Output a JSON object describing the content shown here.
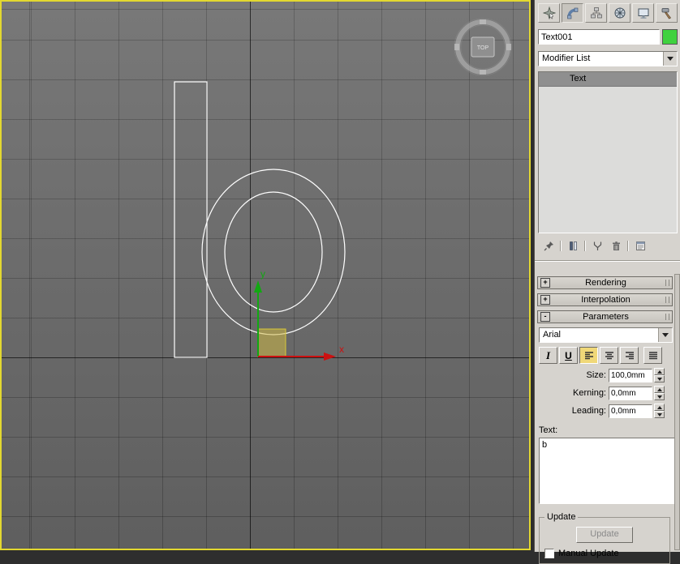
{
  "viewport": {
    "view_label": "TOP",
    "letter": "b",
    "axis_x_label": "x",
    "axis_y_label": "y",
    "colors": {
      "spline": "#ffffff",
      "axis_x": "#cc1111",
      "axis_y": "#12a812",
      "plane_handle_fill": "#cdb845",
      "plane_handle_stroke": "#d8c838",
      "active_border": "#e3d830"
    }
  },
  "command_panel": {
    "tabs": [
      {
        "icon": "create-icon"
      },
      {
        "icon": "modify-icon"
      },
      {
        "icon": "hierarchy-icon"
      },
      {
        "icon": "motion-icon"
      },
      {
        "icon": "display-icon"
      },
      {
        "icon": "utilities-icon"
      }
    ],
    "object_name": "Text001",
    "object_color": "#3fd23f",
    "modifier_list_label": "Modifier List",
    "modifier_stack": [
      {
        "label": "Text"
      }
    ],
    "stack_tools": [
      "pin-stack-icon",
      "show-end-result-icon",
      "make-unique-icon",
      "remove-modifier-icon",
      "configure-modifier-sets-icon"
    ],
    "rollouts": [
      {
        "sign": "+",
        "label": "Rendering"
      },
      {
        "sign": "+",
        "label": "Interpolation"
      },
      {
        "sign": "-",
        "label": "Parameters"
      }
    ],
    "parameters": {
      "font_name": "Arial",
      "italic_label": "I",
      "underline_label": "U",
      "size_label": "Size:",
      "size_value": "100,0mm",
      "kerning_label": "Kerning:",
      "kerning_value": "0,0mm",
      "leading_label": "Leading:",
      "leading_value": "0,0mm",
      "text_label": "Text:",
      "text_value": "b",
      "update": {
        "legend": "Update",
        "button_label": "Update",
        "checkbox_label": "Manual Update"
      }
    }
  }
}
